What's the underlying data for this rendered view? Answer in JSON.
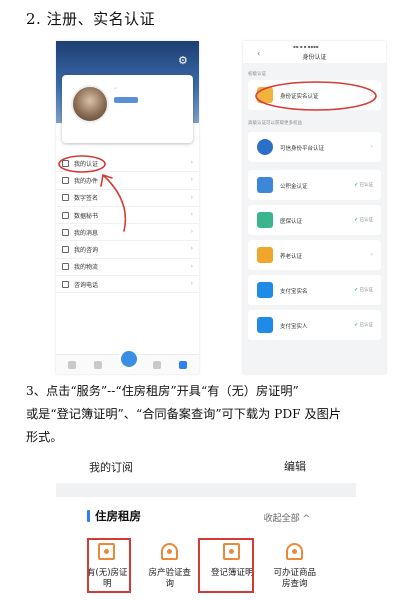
{
  "heading": "2. 注册、实名认证",
  "left_phone": {
    "menu": [
      {
        "label": "我的认证"
      },
      {
        "label": "我的办件"
      },
      {
        "label": "数字签名"
      },
      {
        "label": "数据秘书"
      },
      {
        "label": "我的消息"
      },
      {
        "label": "我的咨询"
      },
      {
        "label": "我的物流"
      },
      {
        "label": "咨询电话"
      }
    ],
    "highlight_color": "#d63a37"
  },
  "right_phone": {
    "title": "身份认证",
    "back": "‹",
    "section1": "初级认证",
    "section2": "高级认证可以获取更多权益",
    "primary_item": "身份证实名认证",
    "items": [
      {
        "label": "可信身份平台认证",
        "status": ""
      },
      {
        "label": "公积金认证",
        "status": "已认证"
      },
      {
        "label": "医保认证",
        "status": "已认证"
      },
      {
        "label": "养老认证",
        "status": ""
      },
      {
        "label": "支付宝实名",
        "status": "已认证"
      },
      {
        "label": "支付宝实人",
        "status": "已认证"
      }
    ]
  },
  "paragraph": {
    "line1": "3、点击“服务”--“住房租房”开具“有（无）房证明”",
    "line2": "或是“登记簿证明”、“合同备案查询”可下载为 PDF 及图片",
    "line3": "形式。"
  },
  "bottom": {
    "subscription": "我的订阅",
    "edit": "编辑",
    "section_title": "住房租房",
    "collapse": "收起全部 ^",
    "services": [
      {
        "line1": "有(无)房证",
        "line2": "明",
        "highlighted": true
      },
      {
        "line1": "房产验证查",
        "line2": "询",
        "highlighted": false
      },
      {
        "line1": "登记簿证明",
        "line2": "",
        "highlighted": true
      },
      {
        "line1": "可办证商品",
        "line2": "房查询",
        "highlighted": false
      }
    ],
    "accent_color": "#2f7ff0",
    "icon_color": "#e98a3b"
  }
}
